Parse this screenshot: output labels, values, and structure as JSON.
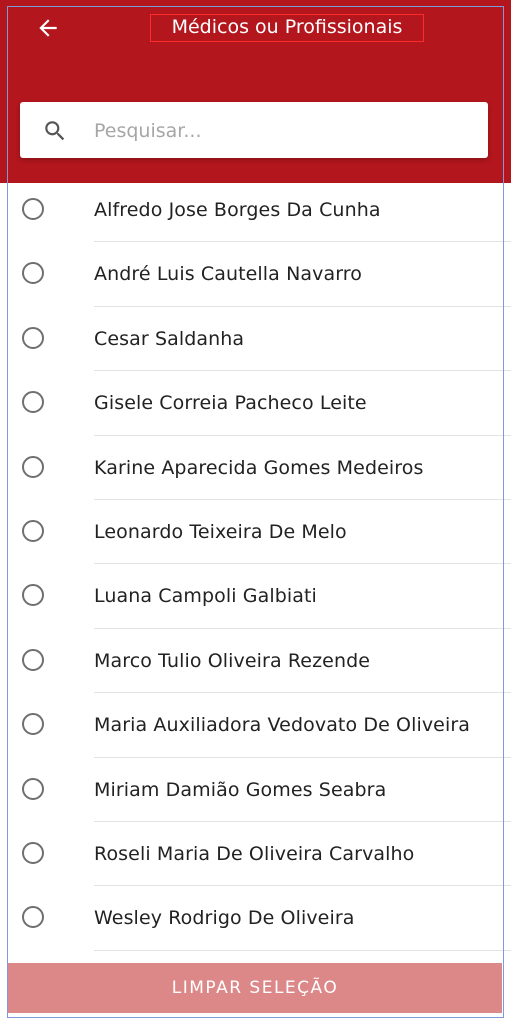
{
  "header": {
    "title": "Médicos ou Profissionais",
    "back_icon": "arrow-left-icon",
    "background_color": "#b3161d"
  },
  "search": {
    "placeholder": "Pesquisar...",
    "value": "",
    "icon": "search-icon"
  },
  "list": {
    "items": [
      {
        "label": "Alfredo Jose Borges Da Cunha",
        "selected": false
      },
      {
        "label": "André Luis Cautella Navarro",
        "selected": false
      },
      {
        "label": "Cesar Saldanha",
        "selected": false
      },
      {
        "label": "Gisele Correia Pacheco Leite",
        "selected": false
      },
      {
        "label": "Karine Aparecida Gomes Medeiros",
        "selected": false
      },
      {
        "label": "Leonardo Teixeira De Melo",
        "selected": false
      },
      {
        "label": "Luana Campoli Galbiati",
        "selected": false
      },
      {
        "label": "Marco Tulio Oliveira Rezende",
        "selected": false
      },
      {
        "label": "Maria Auxiliadora Vedovato De Oliveira",
        "selected": false
      },
      {
        "label": "Miriam Damião Gomes Seabra",
        "selected": false
      },
      {
        "label": "Roseli Maria De Oliveira Carvalho",
        "selected": false
      },
      {
        "label": "Wesley Rodrigo De Oliveira",
        "selected": false
      }
    ]
  },
  "footer": {
    "clear_label": "LIMPAR SELEÇÃO",
    "button_color": "#dc8889"
  }
}
